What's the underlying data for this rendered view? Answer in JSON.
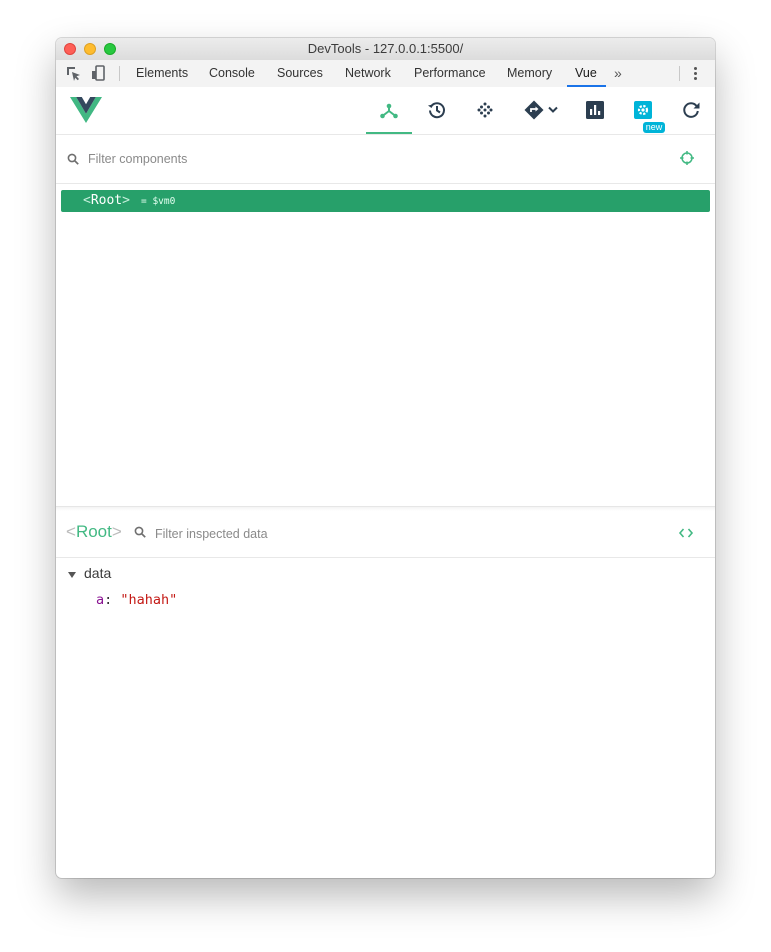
{
  "window": {
    "title": "DevTools - 127.0.0.1:5500/"
  },
  "devtools_tabs": [
    "Elements",
    "Console",
    "Sources",
    "Network",
    "Performance",
    "Memory",
    "Vue"
  ],
  "active_tab": "Vue",
  "more_tabs": "»",
  "vue_toolbar": {
    "buttons": [
      "components-icon",
      "history-icon",
      "vuex-icon",
      "routing-icon",
      "performance-icon",
      "settings-icon",
      "refresh-icon"
    ],
    "active": "components-icon",
    "new_badge": "new",
    "accent_color": "#42b983",
    "badge_color": "#00b4d8"
  },
  "components": {
    "filter_placeholder": "Filter components",
    "tree": [
      {
        "name": "Root",
        "open_bracket": "<",
        "close_bracket": ">",
        "vm": "= $vm0",
        "selected": true
      }
    ],
    "selected_color": "#27a06a"
  },
  "inspector": {
    "component": "Root",
    "open_bracket": "<",
    "close_bracket": ">",
    "filter_placeholder": "Filter inspected data",
    "sections": [
      {
        "name": "data",
        "expanded": true,
        "props": [
          {
            "key": "a",
            "value": "\"hahah\""
          }
        ]
      }
    ]
  }
}
